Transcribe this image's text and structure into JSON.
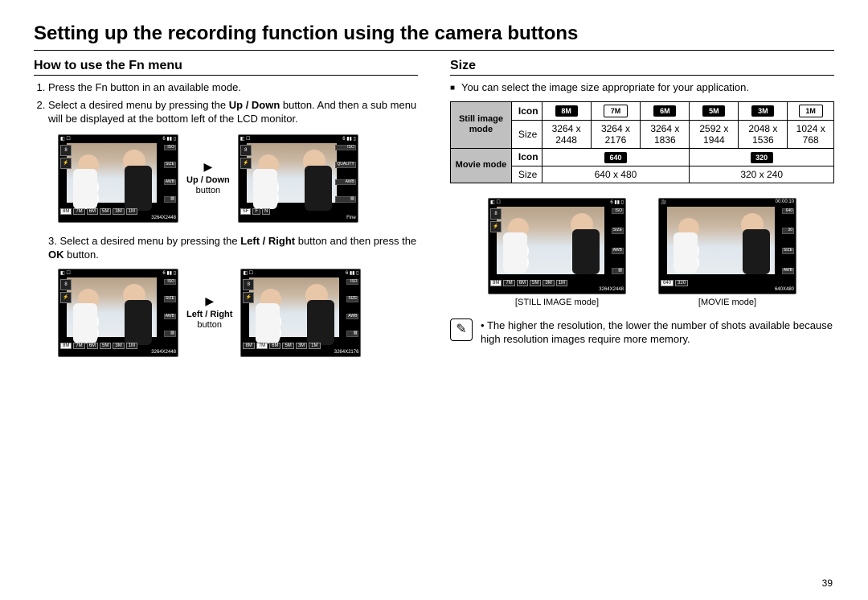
{
  "title": "Setting up the recording function using the camera buttons",
  "left": {
    "heading": "How to use the Fn menu",
    "step1": "Press the Fn button in an available mode.",
    "step2_a": "Select a desired menu by pressing the ",
    "step2_b": "Up / Down",
    "step2_c": " button. And then a sub menu will be displayed at the bottom left of the LCD monitor.",
    "btn1_bold": "Up / Down",
    "btn1_sub": "button",
    "step3_a": "Select a desired menu by pressing the ",
    "step3_b": "Left / Right",
    "step3_c": " button and then press the ",
    "step3_d": "OK",
    "step3_e": " button.",
    "btn2_bold": "Left / Right",
    "btn2_sub": "button",
    "lcd": {
      "a_res": "3264X2448",
      "b_res": "Fine",
      "c_res": "3264X2448",
      "d_res": "3264X2176",
      "b_label": "QUALITY",
      "size_label": "SIZE"
    }
  },
  "right": {
    "heading": "Size",
    "intro": "You can select the image size appropriate for your application.",
    "table": {
      "still_label": "Still image mode",
      "movie_label": "Movie mode",
      "icon_label": "Icon",
      "size_label": "Size",
      "still_icons": [
        "8M",
        "7M",
        "6M",
        "5M",
        "3M",
        "1M"
      ],
      "still_sizes": [
        "3264 x 2448",
        "3264 x 2176",
        "3264 x 1836",
        "2592 x 1944",
        "2048 x 1536",
        "1024 x 768"
      ],
      "movie_icons": [
        "640",
        "320"
      ],
      "movie_sizes": [
        "640 x 480",
        "320 x 240"
      ]
    },
    "captions": {
      "still": "[STILL IMAGE mode]",
      "movie": "[MOVIE mode]"
    },
    "lcd": {
      "still_res": "3264X2448",
      "movie_res": "640X480",
      "movie_time": "00:00:10"
    },
    "note": "The higher the resolution, the lower the number of shots available because high resolution images require more memory."
  },
  "page_number": "39"
}
